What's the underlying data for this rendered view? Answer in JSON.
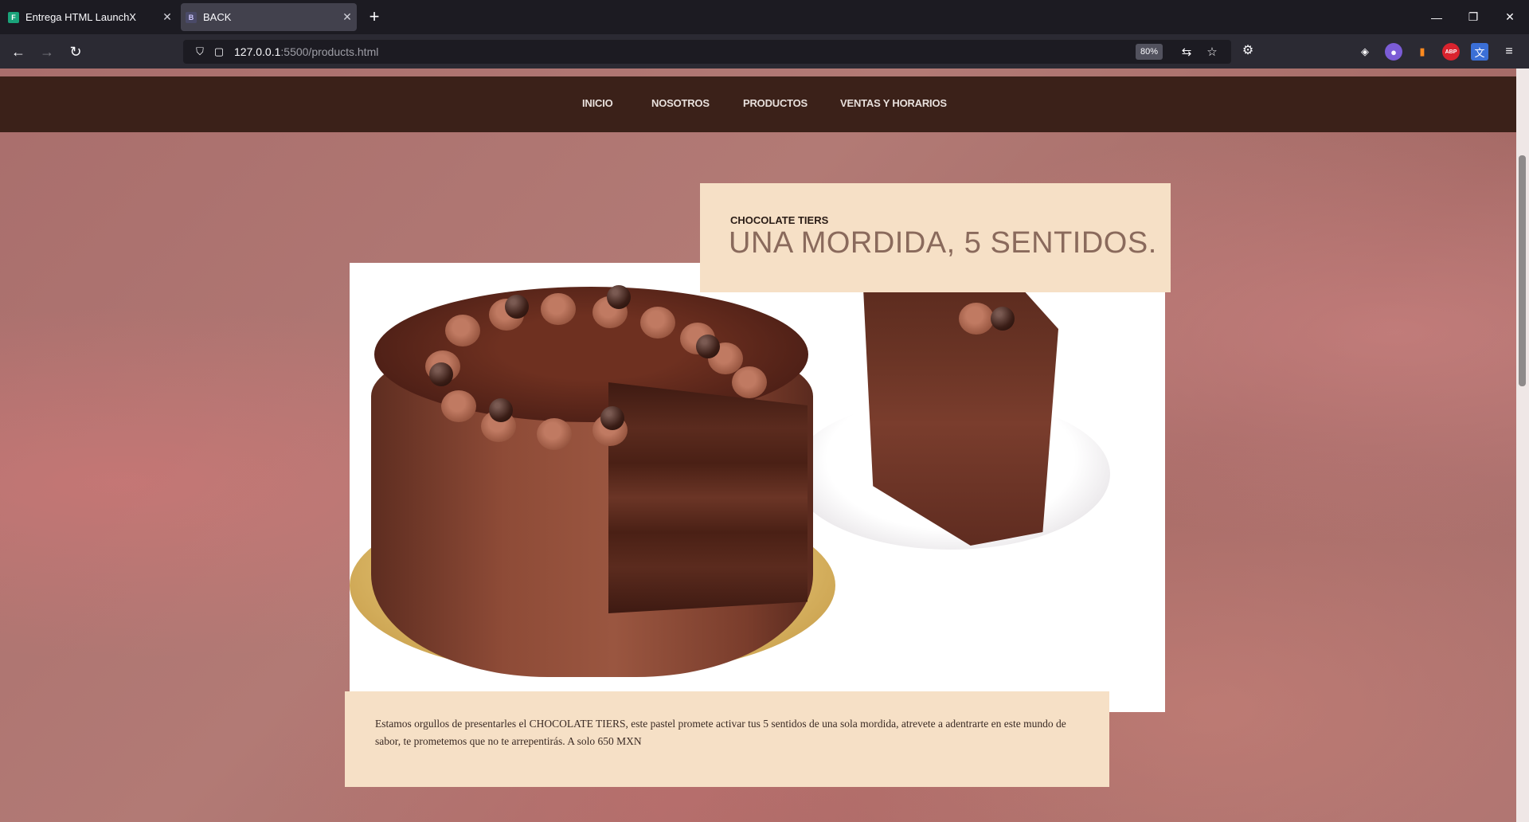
{
  "browser": {
    "tabs": [
      {
        "title": "Entrega HTML LaunchX",
        "active": false
      },
      {
        "title": "BACK",
        "active": true
      }
    ],
    "url_host": "127.0.0.1",
    "url_rest": ":5500/products.html",
    "zoom": "80%"
  },
  "site": {
    "nav": [
      "INICIO",
      "NOSOTROS",
      "PRODUCTOS",
      "VENTAS Y HORARIOS"
    ],
    "product": {
      "kicker": "CHOCOLATE TIERS",
      "headline": "UNA MORDIDA, 5 SENTIDOS.",
      "description": "Estamos orgullos de presentarles el CHOCOLATE TIERS, este pastel promete activar tus 5 sentidos de una sola mordida, atrevete a adentrarte en este mundo de sabor, te prometemos que no te arrepentirás. A solo 650 MXN"
    }
  },
  "colors": {
    "nav_bg": "#3b2119",
    "card_bg": "#f6e0c6",
    "headline": "#8a6a5c"
  }
}
